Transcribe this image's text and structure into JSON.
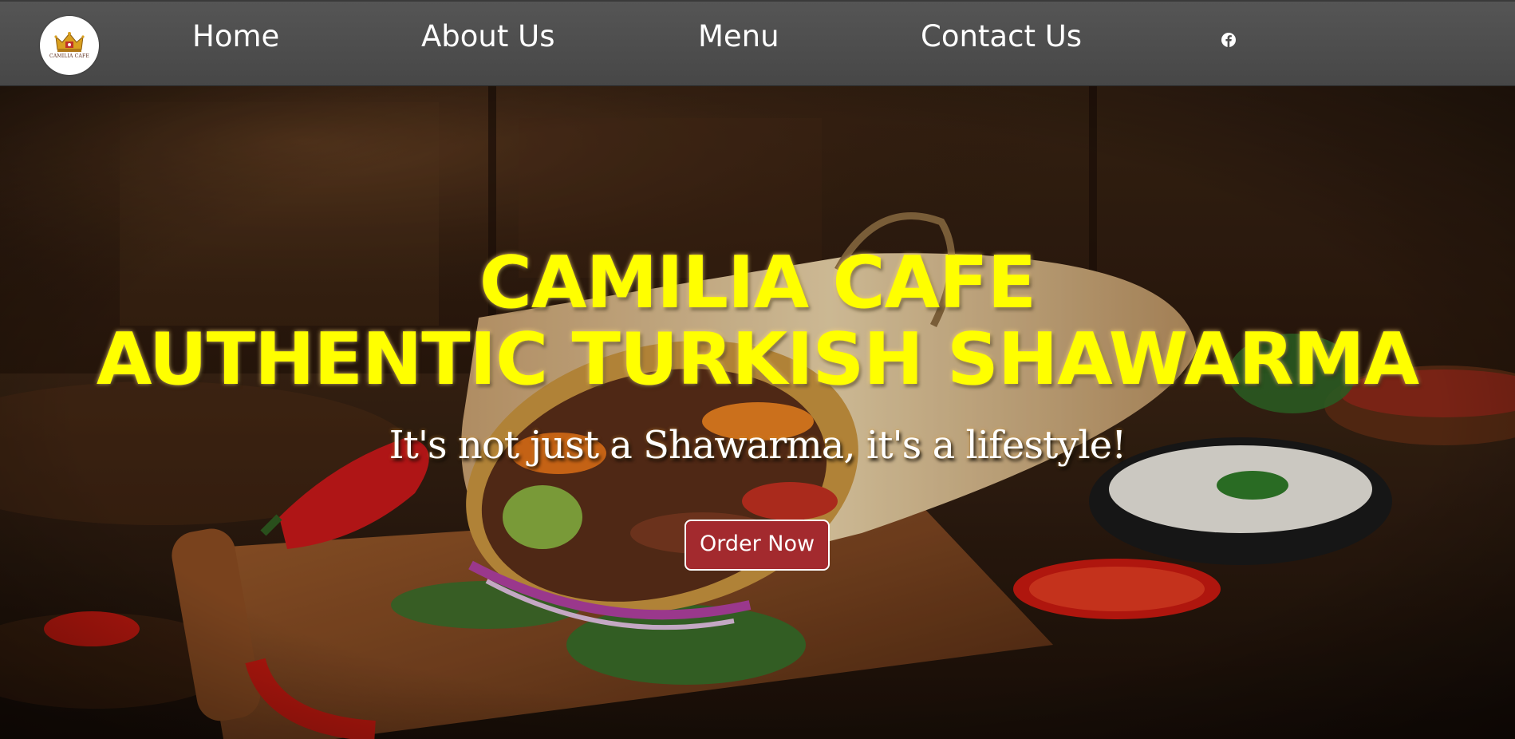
{
  "logo": {
    "alt_text": "CAMILIA CAFE"
  },
  "nav": {
    "items": [
      {
        "label": "Home"
      },
      {
        "label": "About Us"
      },
      {
        "label": "Menu"
      },
      {
        "label": "Contact Us"
      }
    ],
    "social_icon": "facebook-icon"
  },
  "hero": {
    "title_line1": "CAMILIA CAFE",
    "title_line2": "AUTHENTIC TURKISH SHAWARMA",
    "tagline": "It's not just a Shawarma, it's a lifestyle!",
    "cta_label": "Order Now",
    "background_image": "shawarma-wrap-photo"
  },
  "colors": {
    "nav_bg": "#4c4c4c",
    "title_yellow": "#ffff00",
    "cta_bg": "#a32a2e",
    "white": "#ffffff"
  }
}
